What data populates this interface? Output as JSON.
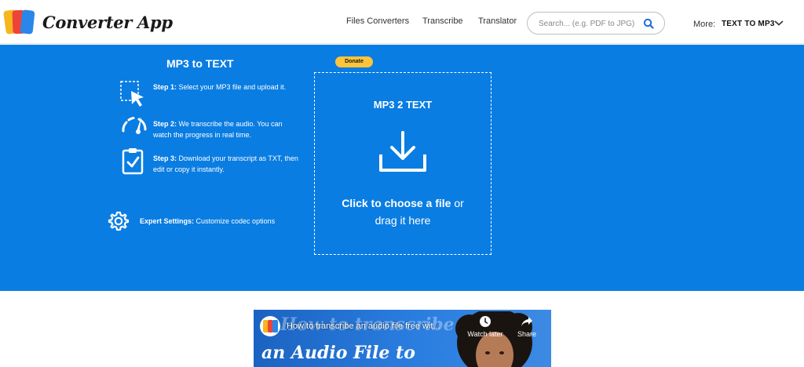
{
  "header": {
    "logo_text": "Converter App",
    "nav": [
      {
        "label": "Files Converters"
      },
      {
        "label": "Transcribe"
      },
      {
        "label": "Translator"
      }
    ],
    "search": {
      "placeholder": "Search... (e.g. PDF to JPG)",
      "icon": "search-icon"
    },
    "more_label": "More:",
    "more_value": "TEXT TO MP3"
  },
  "hero": {
    "title": "MP3 to TEXT",
    "steps": [
      {
        "title": "Step 1:",
        "text": "Select your MP3 file and upload it.",
        "icon": "cursor-selection-icon"
      },
      {
        "title": "Step 2:",
        "text": "We transcribe the audio. You can watch the progress in real time.",
        "icon": "gauge-icon"
      },
      {
        "title": "Step 3:",
        "text": "Download your transcript as TXT, then edit or copy it instantly.",
        "icon": "clipboard-check-icon"
      }
    ],
    "expert": {
      "title": "Expert Settings:",
      "text": "Customize codec options",
      "icon": "gear-icon"
    },
    "donate_label": "Donate",
    "dropzone": {
      "title": "MP3 2 TEXT",
      "icon": "download-icon",
      "action_bold": "Click to choose a file",
      "action_rest": "or",
      "action_line2": "drag it here"
    }
  },
  "video": {
    "title": "How to transcribe an audio file free wit...",
    "overlay_line1": "How to transcribe",
    "overlay_line2": "an Audio File to",
    "watch_later_label": "Watch later",
    "share_label": "Share"
  },
  "colors": {
    "hero_blue": "#0a7de2",
    "donate_yellow": "#ffc439",
    "logo_yellow": "#f6b61e",
    "logo_red": "#ee4437",
    "logo_blue": "#2a86e8"
  }
}
